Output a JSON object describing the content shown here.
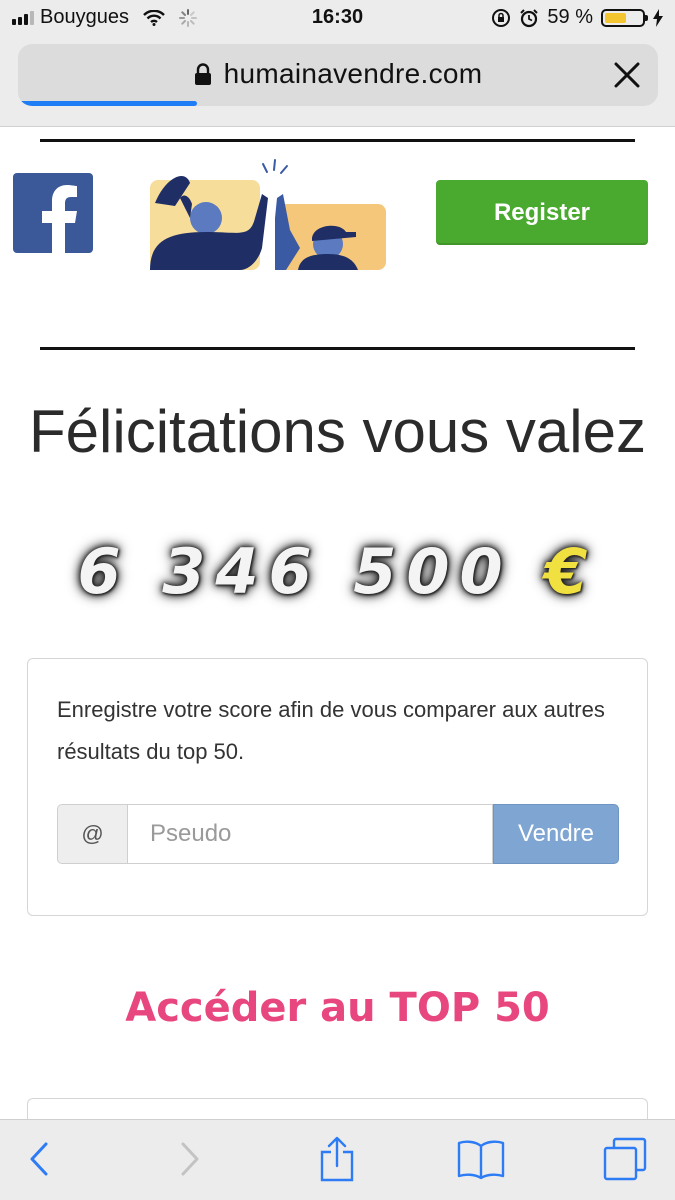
{
  "status_bar": {
    "carrier": "Bouygues",
    "time": "16:30",
    "battery_percent_label": "59 %",
    "battery_level": 0.59
  },
  "browser": {
    "url": "humainavendre.com",
    "load_progress": 0.28,
    "accent_color": "#1f7ef5"
  },
  "header": {
    "register_label": "Register",
    "register_color": "#4aaa30"
  },
  "result": {
    "headline": "Félicitations vous valez",
    "amount": "6 346 500",
    "currency": "€"
  },
  "score_panel": {
    "description": "Enregistre votre score afin de vous comparer aux autres résultats du top 50.",
    "addon_symbol": "@",
    "input_placeholder": "Pseudo",
    "input_value": "",
    "submit_label": "Vendre",
    "submit_color": "#7fa6d2"
  },
  "top50": {
    "link_label": "Accéder au TOP 50",
    "link_color": "#e8467e"
  },
  "toolbar": {
    "icons": [
      "back-icon",
      "forward-icon",
      "share-icon",
      "bookmarks-icon",
      "tabs-icon"
    ]
  }
}
